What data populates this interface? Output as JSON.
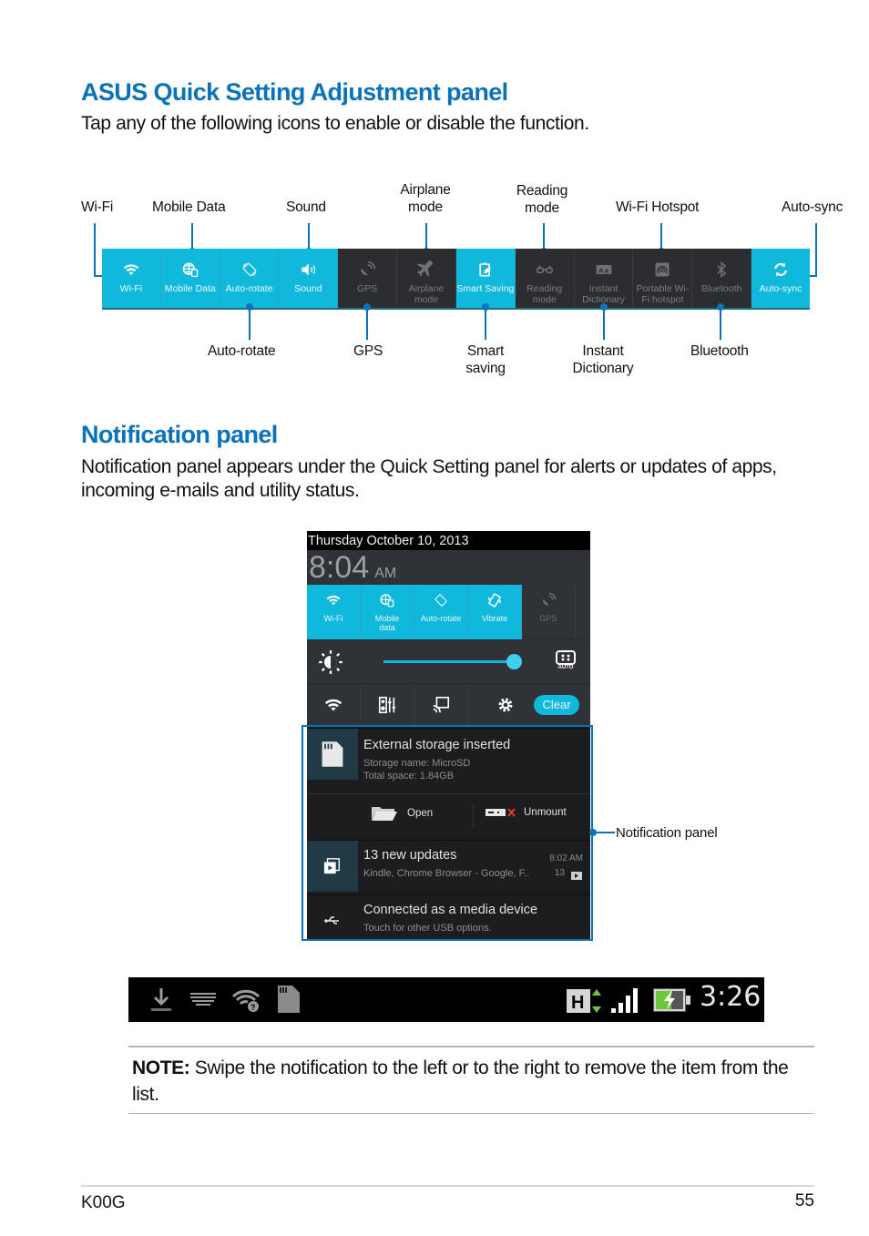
{
  "section1": {
    "title": "ASUS Quick Setting Adjustment panel",
    "description": "Tap any of the following icons to enable or disable the function."
  },
  "quick_settings_bar": {
    "tiles": [
      {
        "label": "Wi-Fi",
        "icon": "wifi-icon",
        "on": true
      },
      {
        "label": "Mobile Data",
        "icon": "globe-icon",
        "on": true
      },
      {
        "label": "Auto-rotate",
        "icon": "rotate-icon",
        "on": true
      },
      {
        "label": "Sound",
        "icon": "speaker-icon",
        "on": true
      },
      {
        "label": "GPS",
        "icon": "gps-icon",
        "on": false
      },
      {
        "label": "Airplane mode",
        "icon": "airplane-icon",
        "on": false
      },
      {
        "label": "Smart Saving",
        "icon": "smart-saving-icon",
        "on": true
      },
      {
        "label": "Reading mode",
        "icon": "glasses-icon",
        "on": false
      },
      {
        "label": "Instant Dictionary",
        "icon": "dictionary-icon",
        "on": false
      },
      {
        "label": "Portable Wi-Fi hotspot",
        "icon": "hotspot-icon",
        "on": false
      },
      {
        "label": "Bluetooth",
        "icon": "bluetooth-icon",
        "on": false
      },
      {
        "label": "Auto-sync",
        "icon": "sync-icon",
        "on": true
      }
    ],
    "callouts_top": [
      "Wi-Fi",
      "Mobile Data",
      "Sound",
      "Airplane mode",
      "Reading mode",
      "Wi-Fi Hotspot",
      "Auto-sync"
    ],
    "callouts_bottom": [
      "Auto-rotate",
      "GPS",
      "Smart saving",
      "Instant Dictionary",
      "Bluetooth"
    ]
  },
  "section2": {
    "title": "Notification panel",
    "description": "Notification panel appears under the Quick Setting panel for alerts or updates of apps, incoming e-mails and utility status."
  },
  "phone": {
    "date": "Thursday October 10, 2013",
    "time": "8:04",
    "ampm": "AM",
    "tiles": [
      {
        "label": "Wi-Fi",
        "on": true
      },
      {
        "label": "Mobile data",
        "on": true
      },
      {
        "label": "Auto-rotate",
        "on": true
      },
      {
        "label": "Vibrate",
        "on": true
      },
      {
        "label": "GPS",
        "on": false
      }
    ],
    "brightness_level": 0.95,
    "brightness_auto_label": "AUTO",
    "clear_label": "Clear",
    "notifications": [
      {
        "title": "External storage inserted",
        "lines": [
          "Storage name: MicroSD",
          "Total space: 1.84GB"
        ],
        "actions": [
          "Open",
          "Unmount"
        ]
      },
      {
        "title": "13 new updates",
        "lines": [
          "Kindle, Chrome Browser - Google, F.."
        ],
        "time": "8:02 AM",
        "count": "13"
      },
      {
        "title": "Connected as a media device",
        "lines": [
          "Touch for other USB options."
        ]
      }
    ],
    "callout": "Notification panel"
  },
  "statusbar": {
    "time": "3:26",
    "network_type": "H",
    "icons_left": [
      "download-icon",
      "keyboard-icon",
      "wifi-unknown-icon",
      "sd-card-icon"
    ],
    "icons_right": [
      "network-h-icon",
      "signal-icon",
      "battery-charging-icon"
    ]
  },
  "note": {
    "label": "NOTE:",
    "text": " Swipe the notification to the left or to the right to remove the item from the list."
  },
  "footer": {
    "model": "K00G",
    "page": "55"
  }
}
